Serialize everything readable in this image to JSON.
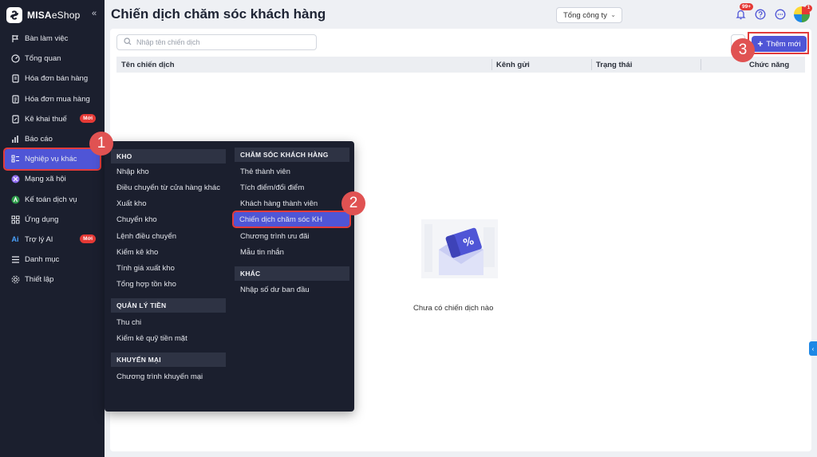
{
  "app": {
    "brand_bold": "MISA",
    "brand_light": "eShop"
  },
  "sidebar": {
    "collapse": "«",
    "items": [
      {
        "label": "Bàn làm việc",
        "icon": "desk-icon"
      },
      {
        "label": "Tổng quan",
        "icon": "gauge-icon"
      },
      {
        "label": "Hóa đơn bán hàng",
        "icon": "invoice-icon"
      },
      {
        "label": "Hóa đơn mua hàng",
        "icon": "purchase-invoice-icon"
      },
      {
        "label": "Kê khai thuế",
        "icon": "tax-icon",
        "badge": "Mới"
      },
      {
        "label": "Báo cáo",
        "icon": "report-icon"
      },
      {
        "label": "Nghiệp vụ khác",
        "icon": "tasks-icon",
        "active": true
      },
      {
        "label": "Mạng xã hội",
        "icon": "social-icon"
      },
      {
        "label": "Kế toán dịch vụ",
        "icon": "accounting-icon"
      },
      {
        "label": "Ứng dụng",
        "icon": "apps-icon"
      },
      {
        "label": "Trợ lý AI",
        "icon": "ai-icon",
        "badge": "Mới"
      },
      {
        "label": "Danh mục",
        "icon": "list-icon"
      },
      {
        "label": "Thiết lập",
        "icon": "settings-icon"
      }
    ]
  },
  "header": {
    "title": "Chiến dịch chăm sóc khách hàng",
    "company": "Tổng công ty",
    "notification_count": "99+",
    "avatar_badge": "1"
  },
  "toolbar": {
    "search_placeholder": "Nhập tên chiến dịch",
    "add_label": "Thêm mới"
  },
  "table": {
    "columns": [
      "Tên chiến dịch",
      "Kênh gửi",
      "Trạng thái",
      "Chức năng"
    ]
  },
  "empty_state": {
    "text": "Chưa có chiến dịch nào"
  },
  "menu": {
    "left": {
      "kho": {
        "title": "KHO",
        "items": [
          "Nhập kho",
          "Điều chuyển từ cửa hàng khác",
          "Xuất kho",
          "Chuyển kho",
          "Lệnh điều chuyển",
          "Kiểm kê kho",
          "Tính giá xuất kho",
          "Tổng hợp tồn kho"
        ]
      },
      "tien": {
        "title": "QUẢN LÝ TIỀN",
        "items": [
          "Thu chi",
          "Kiểm kê quỹ tiền mặt"
        ]
      },
      "km": {
        "title": "KHUYẾN MẠI",
        "items": [
          "Chương trình khuyến mại"
        ]
      }
    },
    "right": {
      "cskh": {
        "title": "CHĂM SÓC KHÁCH HÀNG",
        "items": [
          "Thẻ thành viên",
          "Tích điểm/đổi điểm",
          "Khách hàng thành viên",
          "Chiến dịch chăm sóc KH",
          "Chương trình ưu đãi",
          "Mẫu tin nhắn"
        ]
      },
      "khac": {
        "title": "KHÁC",
        "items": [
          "Nhập số dư ban đầu"
        ]
      }
    }
  },
  "steps": [
    "1",
    "2",
    "3"
  ],
  "colors": {
    "primary": "#4f55d6",
    "sidebar": "#1b1f2e",
    "highlight": "#e23b3b",
    "badge": "#e53935"
  }
}
